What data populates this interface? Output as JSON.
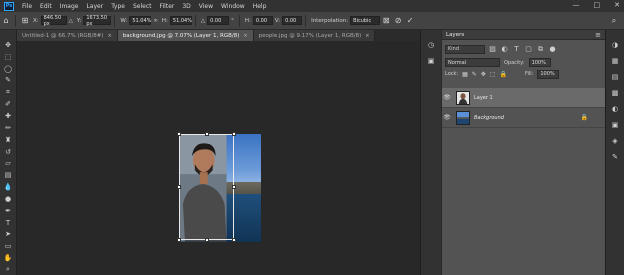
{
  "app": {
    "logo": "Ps"
  },
  "menu": [
    "File",
    "Edit",
    "Image",
    "Layer",
    "Type",
    "Select",
    "Filter",
    "3D",
    "View",
    "Window",
    "Help"
  ],
  "window_controls": {
    "minimize": "—",
    "maximize": "□",
    "close": "✕"
  },
  "options": {
    "x_label": "X:",
    "x_value": "846.50 px",
    "y_label": "Y:",
    "y_value": "1673.50 px",
    "w_label": "W:",
    "w_value": "51.04%",
    "h_label": "H:",
    "h_value": "51.04%",
    "angle_label": "△",
    "angle_value": "0.00",
    "h_skew_label": "H:",
    "h_skew_value": "0.00",
    "v_skew_label": "V:",
    "v_skew_value": "0.00",
    "interpolation_label": "Interpolation:",
    "interpolation_value": "Bicubic"
  },
  "tabs": [
    {
      "label": "Untitled-1 @ 66.7% (RGB/8#)",
      "close": "×",
      "active": false
    },
    {
      "label": "background.jpg @ 7.07% (Layer 1, RGB/8)",
      "close": "×",
      "active": true
    },
    {
      "label": "people.jpg @ 9.17% (Layer 1, RGB/8)",
      "close": "×",
      "active": false
    }
  ],
  "tools": [
    "move-icon",
    "marquee-icon",
    "lasso-icon",
    "quick-select-icon",
    "crop-icon",
    "eyedropper-icon",
    "healing-icon",
    "brush-icon",
    "stamp-icon",
    "history-brush-icon",
    "eraser-icon",
    "gradient-icon",
    "blur-icon",
    "dodge-icon",
    "pen-icon",
    "type-icon",
    "path-select-icon",
    "shape-icon",
    "hand-icon",
    "zoom-icon"
  ],
  "layers_panel": {
    "title": "Layers",
    "filter_placeholder": "Kind",
    "blend_mode": "Normal",
    "opacity_label": "Opacity:",
    "opacity_value": "100%",
    "lock_label": "Lock:",
    "fill_label": "Fill:",
    "fill_value": "100%",
    "layers": [
      {
        "name": "Layer 1",
        "visible": true,
        "selected": true
      },
      {
        "name": "Background",
        "visible": true,
        "selected": false,
        "locked": true
      }
    ]
  }
}
